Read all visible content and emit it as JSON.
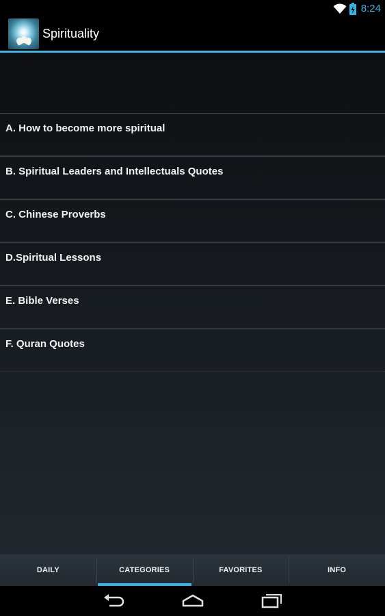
{
  "status_bar": {
    "time": "8:24",
    "icons": [
      "wifi-icon",
      "battery-charging-icon"
    ],
    "accent": "#33b5e5"
  },
  "action_bar": {
    "title": "Spirituality",
    "icon": "app-logo-lotus"
  },
  "categories": [
    {
      "label": "A. How to become more spiritual"
    },
    {
      "label": "B. Spiritual Leaders and Intellectuals Quotes"
    },
    {
      "label": "C. Chinese Proverbs"
    },
    {
      "label": "D.Spiritual Lessons"
    },
    {
      "label": "E. Bible Verses"
    },
    {
      "label": "F. Quran Quotes"
    }
  ],
  "tabs": [
    {
      "label": "DAILY",
      "active": false
    },
    {
      "label": "CATEGORIES",
      "active": true
    },
    {
      "label": "FAVORITES",
      "active": false
    },
    {
      "label": "INFO",
      "active": false
    }
  ],
  "nav_bar": {
    "icons": [
      "back-icon",
      "home-icon",
      "recent-apps-icon"
    ]
  },
  "colors": {
    "accent": "#33b5e5",
    "background": "#15191d"
  }
}
